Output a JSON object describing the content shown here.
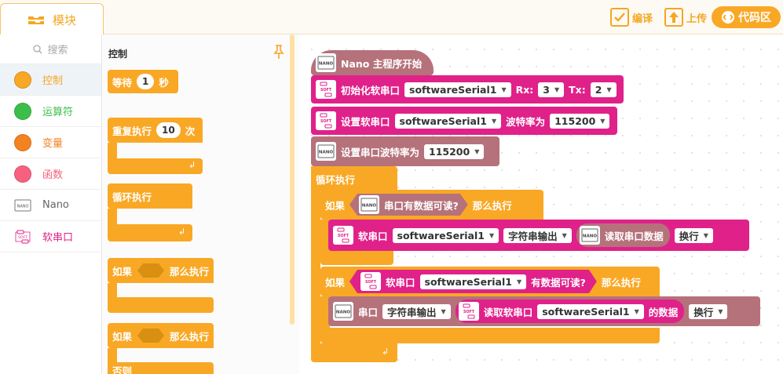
{
  "topbar": {
    "module_tab": "模块",
    "compile": "编译",
    "upload": "上传",
    "code_area": "代码区"
  },
  "sidebar": {
    "search_placeholder": "搜索",
    "categories": [
      {
        "label": "控制",
        "color": "#f9a825"
      },
      {
        "label": "运算符",
        "color": "#3cbf4a"
      },
      {
        "label": "变量",
        "color": "#f58220"
      },
      {
        "label": "函数",
        "color": "#f7617f"
      },
      {
        "label": "Nano",
        "color": "#8a8a8a"
      },
      {
        "label": "软串口",
        "color": "#e0218a"
      }
    ]
  },
  "flyout": {
    "title": "控制",
    "wait": {
      "label": "等待",
      "value": "1",
      "unit": "秒"
    },
    "repeat": {
      "label": "重复执行",
      "value": "10",
      "unit": "次"
    },
    "forever": "循环执行",
    "if1": {
      "if": "如果",
      "then": "那么执行"
    },
    "if2": {
      "if": "如果",
      "then": "那么执行",
      "else": "否则"
    }
  },
  "workspace": {
    "nano_start": "Nano 主程序开始",
    "init_serial": {
      "label": "初始化软串口",
      "port": "softwareSerial1",
      "rx_label": "Rx:",
      "rx": "3",
      "tx_label": "Tx:",
      "tx": "2"
    },
    "set_soft_serial": {
      "label": "设置软串口",
      "port": "softwareSerial1",
      "baud_label": "波特率为",
      "baud": "115200"
    },
    "set_serial": {
      "label": "设置串口波特率为",
      "baud": "115200"
    },
    "loop": "循环执行",
    "if_a": {
      "if": "如果",
      "cond": "串口有数据可读?",
      "then": "那么执行"
    },
    "soft_print": {
      "label": "软串口",
      "port": "softwareSerial1",
      "mode": "字符串输出",
      "read": "读取串口数据",
      "newline": "换行"
    },
    "if_b": {
      "if": "如果",
      "label": "软串口",
      "port": "softwareSerial1",
      "cond": "有数据可读?",
      "then": "那么执行"
    },
    "serial_print": {
      "label": "串口",
      "mode": "字符串输出",
      "read": "读取软串口",
      "port": "softwareSerial1",
      "suffix": "的数据",
      "newline": "换行"
    }
  },
  "icons": {
    "device_text": "NANO",
    "soft_text": "SOFT"
  },
  "colors": {
    "control": "#f9a825",
    "nano": "#b5727b",
    "soft_serial": "#e0218a",
    "accent": "#f5a623"
  }
}
